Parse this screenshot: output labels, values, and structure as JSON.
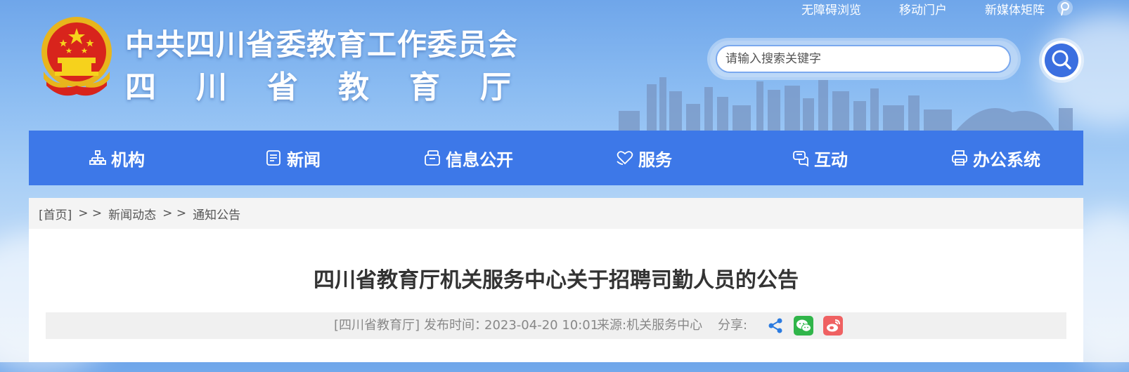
{
  "header": {
    "title_line1": "中共四川省委教育工作委员会",
    "title_line2": "四川省教育厅",
    "top_links": [
      "无障碍浏览",
      "移动门户",
      "新媒体矩阵"
    ]
  },
  "search": {
    "placeholder": "请输入搜索关键字"
  },
  "nav": {
    "items": [
      {
        "label": "机构",
        "icon": "org-chart-icon"
      },
      {
        "label": "新闻",
        "icon": "news-icon"
      },
      {
        "label": "信息公开",
        "icon": "info-icon"
      },
      {
        "label": "服务",
        "icon": "service-heart-icon"
      },
      {
        "label": "互动",
        "icon": "chat-icon"
      },
      {
        "label": "办公系统",
        "icon": "printer-icon"
      }
    ]
  },
  "breadcrumb": {
    "items": [
      "[首页]",
      "新闻动态",
      "通知公告"
    ],
    "separator": "> >"
  },
  "article": {
    "title": "四川省教育厅机关服务中心关于招聘司勤人员的公告",
    "site": "[四川省教育厅]",
    "publish_label": "发布时间：",
    "publish_time": "2023-04-20 10:01",
    "source": "来源:机关服务中心",
    "share_label": "分享:"
  },
  "colors": {
    "nav_bg": "#3d78e8",
    "search_btn": "#3b6fe0",
    "wechat": "#30b54a",
    "weibo": "#ef6162"
  }
}
